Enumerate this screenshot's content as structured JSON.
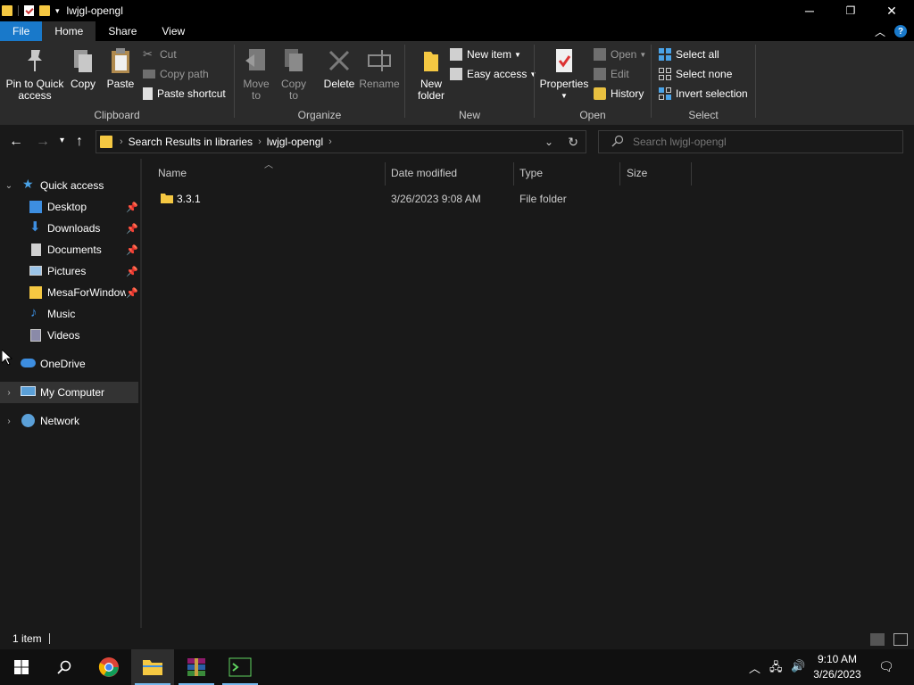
{
  "window": {
    "title": "lwjgl-opengl",
    "controls": {
      "minimize": "─",
      "restore": "❐",
      "close": "✕"
    }
  },
  "ribbon_tabs": [
    {
      "label": "File"
    },
    {
      "label": "Home"
    },
    {
      "label": "Share"
    },
    {
      "label": "View"
    }
  ],
  "ribbon": {
    "clipboard": {
      "group_label": "Clipboard",
      "pin_label_1": "Pin to Quick",
      "pin_label_2": "access",
      "copy_label": "Copy",
      "paste_label": "Paste",
      "cut_label": "Cut",
      "copy_path_label": "Copy path",
      "paste_shortcut_label": "Paste shortcut"
    },
    "organize": {
      "group_label": "Organize",
      "move_to_1": "Move",
      "move_to_2": "to",
      "copy_to_1": "Copy",
      "copy_to_2": "to",
      "delete_label": "Delete",
      "rename_label": "Rename"
    },
    "new": {
      "group_label": "New",
      "new_folder_1": "New",
      "new_folder_2": "folder",
      "new_item_label": "New item",
      "easy_access_label": "Easy access"
    },
    "open": {
      "group_label": "Open",
      "properties_label": "Properties",
      "open_label": "Open",
      "edit_label": "Edit",
      "history_label": "History"
    },
    "select": {
      "group_label": "Select",
      "select_all_label": "Select all",
      "select_none_label": "Select none",
      "invert_selection_label": "Invert selection"
    }
  },
  "address": {
    "crumbs": [
      "Search Results in libraries",
      "lwjgl-opengl"
    ],
    "search_placeholder": "Search lwjgl-opengl"
  },
  "sidebar": {
    "items": [
      {
        "label": "Quick access",
        "icon": "star-icon"
      },
      {
        "label": "Desktop",
        "icon": "desktop-icon",
        "pinned": true
      },
      {
        "label": "Downloads",
        "icon": "download-icon",
        "pinned": true
      },
      {
        "label": "Documents",
        "icon": "document-icon",
        "pinned": true
      },
      {
        "label": "Pictures",
        "icon": "picture-icon",
        "pinned": true
      },
      {
        "label": "MesaForWindows",
        "icon": "folder-icon",
        "pinned": true
      },
      {
        "label": "Music",
        "icon": "music-icon"
      },
      {
        "label": "Videos",
        "icon": "video-icon"
      },
      {
        "label": "OneDrive",
        "icon": "cloud-icon"
      },
      {
        "label": "My Computer",
        "icon": "computer-icon",
        "selected": true
      },
      {
        "label": "Network",
        "icon": "network-icon"
      }
    ]
  },
  "columns": {
    "name": "Name",
    "date_modified": "Date modified",
    "type": "Type",
    "size": "Size"
  },
  "files": [
    {
      "name": "3.3.1",
      "date_modified": "3/26/2023 9:08 AM",
      "type": "File folder",
      "size": ""
    }
  ],
  "status": {
    "count": "1 item"
  },
  "taskbar": {
    "time": "9:10 AM",
    "date": "3/26/2023"
  },
  "colors": {
    "accent": "#1979ca",
    "folder": "#f5c842",
    "background": "#191919",
    "ribbon": "#2b2b2b"
  }
}
